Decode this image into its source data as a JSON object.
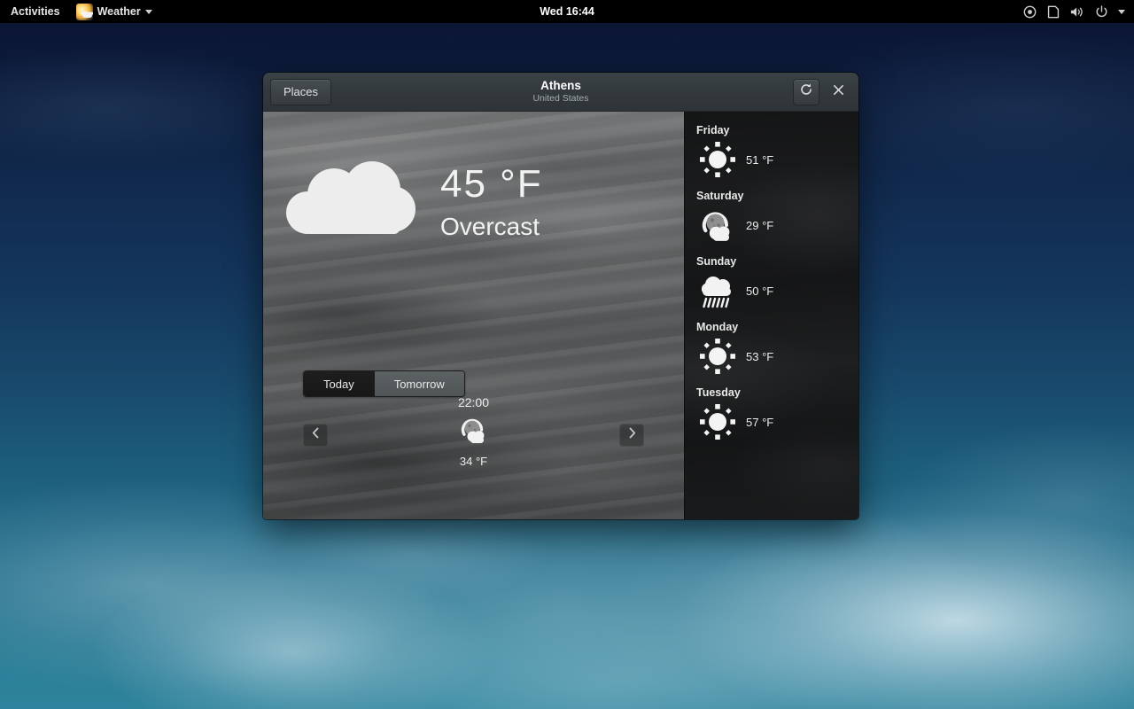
{
  "topbar": {
    "activities": "Activities",
    "app_name": "Weather",
    "app_icon": "weather-app-icon",
    "clock": "Wed 16:44",
    "menu_arrow_icon": "chevron-down-icon",
    "tray": [
      {
        "name": "accessibility-icon",
        "label": "Accessibility"
      },
      {
        "name": "screen-icon",
        "label": "Screen"
      },
      {
        "name": "volume-icon",
        "label": "Volume"
      },
      {
        "name": "power-icon",
        "label": "Power"
      },
      {
        "name": "chevron-down-icon",
        "label": "System menu"
      }
    ]
  },
  "window": {
    "header": {
      "places_label": "Places",
      "title": "Athens",
      "subtitle": "United States",
      "refresh_icon": "refresh-icon",
      "close_icon": "close-icon"
    },
    "current": {
      "icon": "overcast-cloud-icon",
      "temperature": "45 °F",
      "condition": "Overcast"
    },
    "day_toggle": {
      "today_label": "Today",
      "tomorrow_label": "Tomorrow",
      "selected": "Today"
    },
    "hourly": {
      "prev_icon": "chevron-left-icon",
      "next_icon": "chevron-right-icon",
      "entries": [
        {
          "time": "22:00",
          "icon": "few-clouds-night-icon",
          "temperature": "34 °F"
        }
      ]
    },
    "forecast": [
      {
        "day": "Friday",
        "icon": "clear-sun-icon",
        "temperature": "51 °F"
      },
      {
        "day": "Saturday",
        "icon": "few-clouds-night-icon",
        "temperature": "29 °F"
      },
      {
        "day": "Sunday",
        "icon": "showers-rain-icon",
        "temperature": "50 °F"
      },
      {
        "day": "Monday",
        "icon": "clear-sun-icon",
        "temperature": "53 °F"
      },
      {
        "day": "Tuesday",
        "icon": "clear-sun-icon",
        "temperature": "57 °F"
      }
    ]
  },
  "colors": {
    "topbar_bg": "#000000",
    "headerbar_bg": "#33393c",
    "sidebar_bg": "#16181a",
    "text_primary": "#ffffff",
    "text_secondary": "#a6adb0",
    "desktop_top": "#0a1430",
    "desktop_bottom": "#2e849c"
  }
}
